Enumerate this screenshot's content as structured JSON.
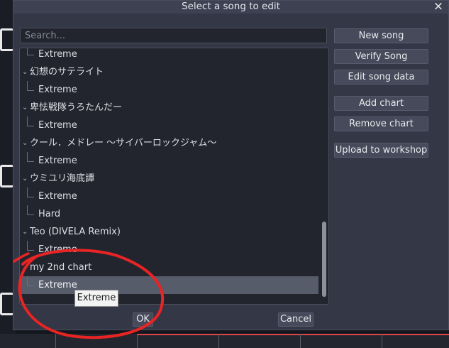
{
  "dialog": {
    "title": "Select a song to edit",
    "close_icon": "×"
  },
  "search": {
    "placeholder": "Search...",
    "value": ""
  },
  "tree": {
    "rows": [
      {
        "kind": "child",
        "label": "Extreme"
      },
      {
        "kind": "song",
        "label": "幻想のサテライト"
      },
      {
        "kind": "child",
        "label": "Extreme"
      },
      {
        "kind": "song",
        "label": "卑怯戦隊うろたんだー"
      },
      {
        "kind": "child",
        "label": "Extreme"
      },
      {
        "kind": "song",
        "label": "クール．メドレー ～サイバーロックジャム～"
      },
      {
        "kind": "child",
        "label": "Extreme"
      },
      {
        "kind": "song",
        "label": "ウミユリ海底譚"
      },
      {
        "kind": "child",
        "label": "Extreme"
      },
      {
        "kind": "child",
        "label": "Hard"
      },
      {
        "kind": "song",
        "label": "Teo (DIVELA Remix)"
      },
      {
        "kind": "child",
        "label": "Extreme"
      },
      {
        "kind": "song",
        "label": "my 2nd chart"
      },
      {
        "kind": "child",
        "label": "Extreme",
        "selected": true
      }
    ],
    "scroll_position": 0.69
  },
  "tooltip": {
    "text": "Extreme"
  },
  "side_buttons": {
    "new_song": "New song",
    "verify_song": "Verify Song",
    "edit_song_data": "Edit song data",
    "add_chart": "Add chart",
    "remove_chart": "Remove chart",
    "upload_workshop": "Upload to workshop"
  },
  "footer": {
    "ok": "OK",
    "cancel": "Cancel"
  },
  "colors": {
    "dialog_bg": "#343746",
    "list_bg": "#23252e",
    "selection": "#575c6a",
    "button_bg": "#464a5a",
    "annotation_red": "#e82424"
  }
}
